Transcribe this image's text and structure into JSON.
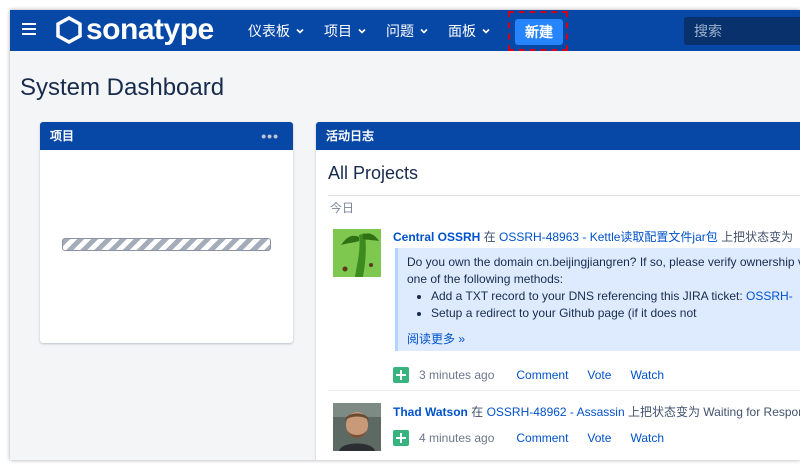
{
  "topbar": {
    "logo_text": "sonatype",
    "nav": [
      {
        "label": "仪表板"
      },
      {
        "label": "项目"
      },
      {
        "label": "问题"
      },
      {
        "label": "面板"
      }
    ],
    "create_label": "新建",
    "search_placeholder": "搜索",
    "color": "#0747a6",
    "create_color": "#2684ff"
  },
  "page": {
    "title": "System Dashboard"
  },
  "projects_gadget": {
    "title": "项目",
    "menu": "•••"
  },
  "activity_gadget": {
    "title": "活动日志",
    "stream_title": "All Projects",
    "day_label": "今日",
    "entries": [
      {
        "actor": "Central OSSRH",
        "connector": " 在 ",
        "issue": "OSSRH-48963 - Kettle读取配置文件jar包",
        "action": " 上把状态变为",
        "quote_text": "Do you own the domain cn.beijingjiangren? If so, please verify ownership via one of the following methods:",
        "bullets": [
          {
            "before": "Add a TXT record to your DNS referencing this JIRA ticket: ",
            "link": "OSSRH-"
          },
          {
            "before": "Setup a redirect to your Github page (if it does not",
            "link": ""
          }
        ],
        "more": "阅读更多 »",
        "time": "3 minutes ago",
        "actions": [
          "Comment",
          "Vote",
          "Watch"
        ]
      },
      {
        "actor": "Thad Watson",
        "connector": " 在 ",
        "issue": "OSSRH-48962 - Assassin",
        "action": " 上把状态变为 Waiting for Response",
        "time": "4 minutes ago",
        "actions": [
          "Comment",
          "Vote",
          "Watch"
        ]
      }
    ]
  }
}
